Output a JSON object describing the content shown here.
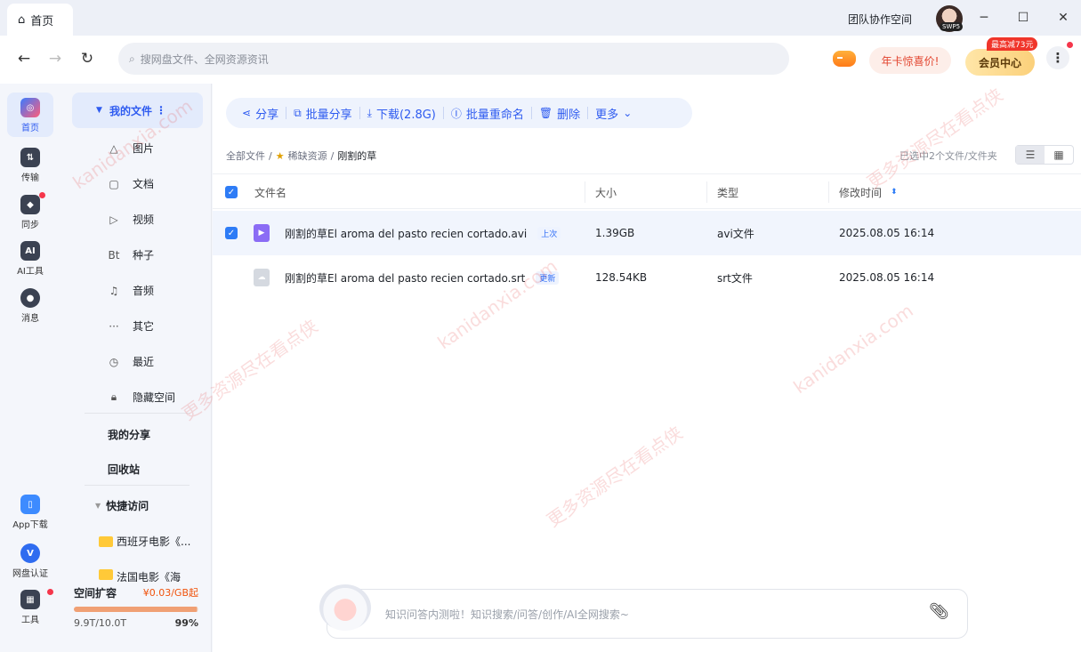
{
  "titlebar": {
    "home_tab": "首页",
    "team_space": "团队协作空间",
    "avatar_tag": "SWP5"
  },
  "toolbar": {
    "search_placeholder": "搜网盘文件、全网资源资讯",
    "promo": "年卡惊喜价!",
    "vip_center": "会员中心",
    "vip_tag": "最高减73元"
  },
  "rail": {
    "items": [
      {
        "label": "首页",
        "icon": "home-cloud-icon"
      },
      {
        "label": "传输",
        "icon": "transfer-icon"
      },
      {
        "label": "同步",
        "icon": "sync-icon"
      },
      {
        "label": "AI工具",
        "icon": "ai-tool-icon"
      },
      {
        "label": "消息",
        "icon": "message-icon"
      },
      {
        "label": "App下载",
        "icon": "phone-icon"
      },
      {
        "label": "网盘认证",
        "icon": "verify-icon"
      },
      {
        "label": "工具",
        "icon": "tools-icon"
      }
    ]
  },
  "tree": {
    "my_files": "我的文件",
    "items": [
      {
        "label": "图片",
        "icon": "image-icon"
      },
      {
        "label": "文档",
        "icon": "document-icon"
      },
      {
        "label": "视频",
        "icon": "video-icon"
      },
      {
        "label": "种子",
        "icon": "torrent-icon"
      },
      {
        "label": "音频",
        "icon": "audio-icon"
      },
      {
        "label": "其它",
        "icon": "more-icon"
      },
      {
        "label": "最近",
        "icon": "recent-icon"
      },
      {
        "label": "隐藏空间",
        "icon": "lock-icon"
      }
    ],
    "my_share": "我的分享",
    "recycle": "回收站",
    "quick_access": "快捷访问",
    "folders": [
      "西班牙电影《...",
      "法国电影《海"
    ],
    "space": {
      "title": "空间扩容",
      "price": "¥0.03/GB起",
      "used": "9.9T/10.0T",
      "percent": "99%",
      "fill_fraction": 0.99
    }
  },
  "actions": {
    "share": "分享",
    "batch_share": "批量分享",
    "download": "下载(2.8G)",
    "batch_rename": "批量重命名",
    "delete": "删除",
    "more": "更多"
  },
  "breadcrumb": {
    "root": "全部文件",
    "sep": "/",
    "folder": "稀缺资源",
    "current": "刚割的草"
  },
  "selection_info": "已选中2个文件/文件夹",
  "table": {
    "headers": {
      "name": "文件名",
      "size": "大小",
      "type": "类型",
      "modified": "修改时间"
    },
    "rows": [
      {
        "name": "刚割的草El aroma del pasto recien cortado.avi",
        "badge": "上次",
        "size": "1.39GB",
        "type": "avi文件",
        "modified": "2025.08.05 16:14",
        "selected": true
      },
      {
        "name": "刚割的草El aroma del pasto recien cortado.srt",
        "badge": "更新",
        "size": "128.54KB",
        "type": "srt文件",
        "modified": "2025.08.05 16:14",
        "selected": false
      }
    ]
  },
  "chat": {
    "placeholder": "知识问答内测啦！知识搜索/问答/创作/AI全网搜索~"
  },
  "watermark": [
    "kanidanxia.com",
    "更多资源尽在看点侠"
  ],
  "colors": {
    "accent": "#2e5bf0",
    "promo": "#e2432d",
    "space_bar": "#f0a074"
  }
}
